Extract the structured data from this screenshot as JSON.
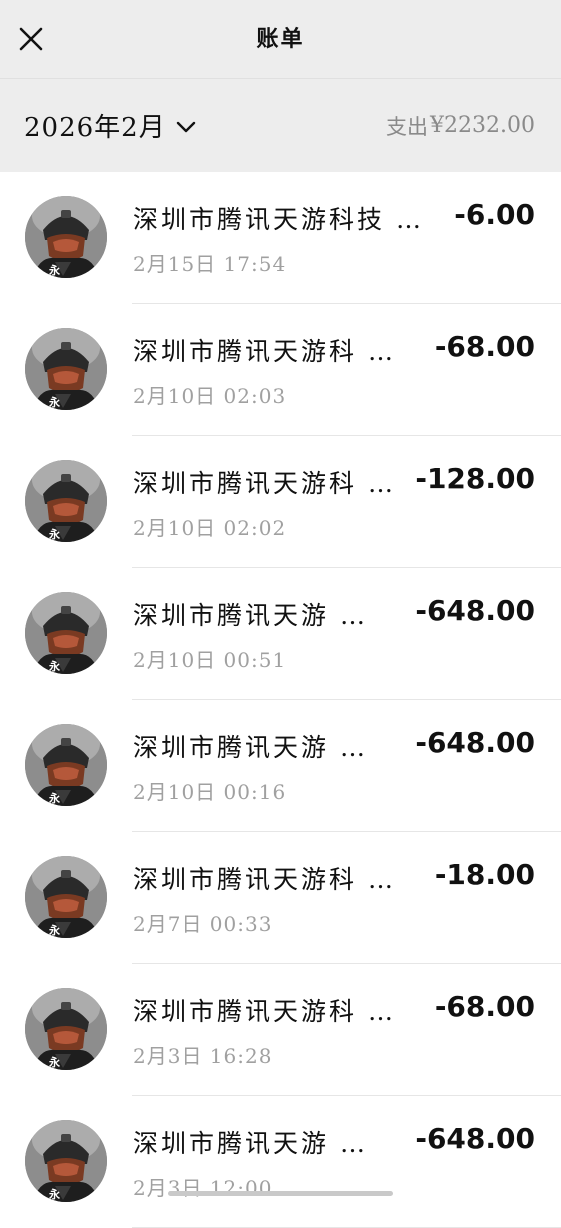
{
  "header": {
    "title": "账单",
    "close_icon": "close-icon"
  },
  "filter": {
    "month_label": "2026年2月",
    "dropdown_icon": "chevron-down-icon",
    "summary_label": "支出",
    "summary_amount": "¥2232.00"
  },
  "transactions": [
    {
      "merchant": "深圳市腾讯天游科技 …",
      "time": "2月15日 17:54",
      "amount": "-6.00"
    },
    {
      "merchant": "深圳市腾讯天游科 …",
      "time": "2月10日 02:03",
      "amount": "-68.00"
    },
    {
      "merchant": "深圳市腾讯天游科 …",
      "time": "2月10日 02:02",
      "amount": "-128.00"
    },
    {
      "merchant": "深圳市腾讯天游 …",
      "time": "2月10日 00:51",
      "amount": "-648.00"
    },
    {
      "merchant": "深圳市腾讯天游 …",
      "time": "2月10日 00:16",
      "amount": "-648.00"
    },
    {
      "merchant": "深圳市腾讯天游科 …",
      "time": "2月7日 00:33",
      "amount": "-18.00"
    },
    {
      "merchant": "深圳市腾讯天游科 …",
      "time": "2月3日 16:28",
      "amount": "-68.00"
    },
    {
      "merchant": "深圳市腾讯天游 …",
      "time": "2月3日 12:00",
      "amount": "-648.00"
    }
  ],
  "colors": {
    "header_bg": "#ededed",
    "list_bg": "#ffffff",
    "secondary_text": "#a0a0a0",
    "divider": "#e6e6e6"
  }
}
